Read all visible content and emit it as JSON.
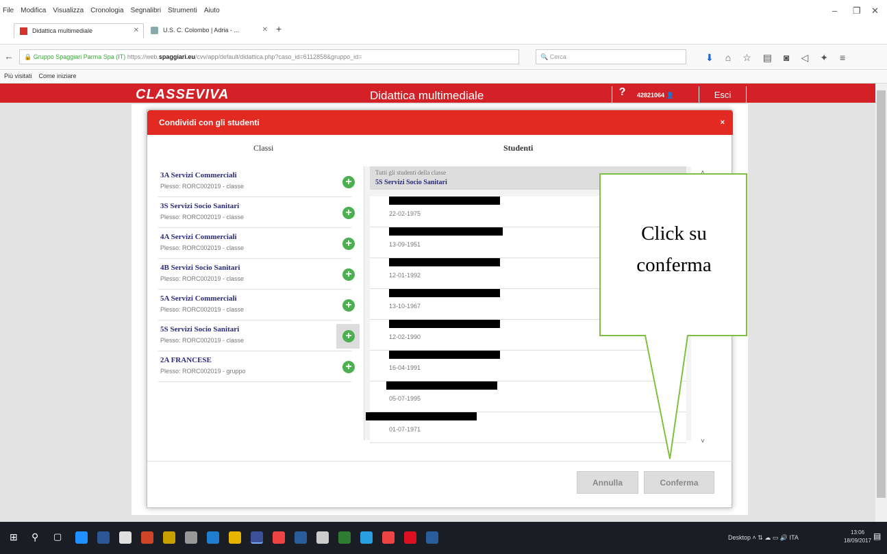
{
  "browser": {
    "menu": [
      "File",
      "Modifica",
      "Visualizza",
      "Cronologia",
      "Segnalibri",
      "Strumenti",
      "Aiuto"
    ],
    "tabs": [
      {
        "title": "Didattica multimediale"
      },
      {
        "title": "U.S. C. Colombo | Adria - ..."
      }
    ],
    "url_identity": "Gruppo Spaggiari Parma Spa (IT)",
    "url_prefix": "https://web.",
    "url_domain": "spaggiari.eu",
    "url_path": "/cvv/app/default/didattica.php?caso_id=6112858&gruppo_id=",
    "search_placeholder": "Cerca",
    "bookmarks": [
      "Più visitati",
      "Come iniziare"
    ]
  },
  "page": {
    "logo": "CLASSEVIVA",
    "title": "Didattica multimediale",
    "help": "?",
    "user_id": "42821064",
    "logout": "Esci"
  },
  "modal": {
    "title": "Condividi con gli studenti",
    "close": "×",
    "col_classes": "Classi",
    "col_students": "Studenti",
    "classes": [
      {
        "name": "3A Servizi Commerciali",
        "sub": "Plesso: RORC002019 - classe"
      },
      {
        "name": "3S Servizi Socio Sanitari",
        "sub": "Plesso: RORC002019 - classe"
      },
      {
        "name": "4A Servizi Commerciali",
        "sub": "Plesso: RORC002019 - classe"
      },
      {
        "name": "4B Servizi Socio Sanitari",
        "sub": "Plesso: RORC002019 - classe"
      },
      {
        "name": "5A Servizi Commerciali",
        "sub": "Plesso: RORC002019 - classe"
      },
      {
        "name": "5S Servizi Socio Sanitari",
        "sub": "Plesso: RORC002019 - classe"
      },
      {
        "name": "2A FRANCESE",
        "sub": "Plesso: RORC002019 - gruppo"
      }
    ],
    "students_all": "Tutti gli studenti della classe",
    "students_class": "5S Servizi Socio Sanitari",
    "students": [
      {
        "birth": "22-02-1975"
      },
      {
        "birth": "13-09-1951"
      },
      {
        "birth": "12-01-1992"
      },
      {
        "birth": "13-10-1967"
      },
      {
        "birth": "12-02-1990"
      },
      {
        "birth": "16-04-1991"
      },
      {
        "birth": "05-07-1995"
      },
      {
        "birth": "01-07-1971"
      }
    ],
    "btn_cancel": "Annulla",
    "btn_confirm": "Conferma"
  },
  "callout": {
    "line1": "Click su",
    "line2": "conferma"
  },
  "taskbar": {
    "tray_label": "Desktop",
    "lang": "ITA",
    "time": "13:06",
    "date": "18/09/2017"
  }
}
